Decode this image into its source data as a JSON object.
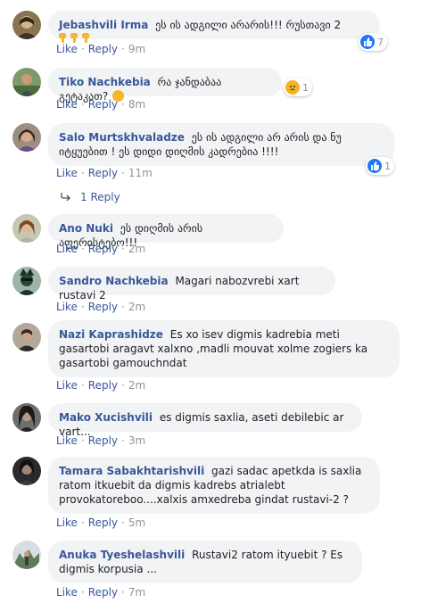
{
  "actions": {
    "like": "Like",
    "reply": "Reply",
    "sep": "·"
  },
  "comments": [
    {
      "author": "Jebashvili Irma",
      "text": "ეს ის ადგილი არარის!!! რუსთავი 2",
      "time": "9m",
      "reaction": {
        "icon": "like-icon",
        "count": "7"
      },
      "emoji": "thumbs-down-icon x3"
    },
    {
      "author": "Tiko Nachkebia",
      "text": "რა ჯანდაბაა გეტაკათ?",
      "time": "8m",
      "reaction": {
        "icon": "sad-icon",
        "count": "1"
      },
      "emoji": "sad-face-icon"
    },
    {
      "author": "Salo Murtskhvaladze",
      "text": "ეს ის ადგილი არ არის და ნუ იტყუებით ! ეს დიდი დიღმის კადრებია !!!!",
      "time": "11m",
      "reaction": {
        "icon": "like-icon",
        "count": "1"
      }
    },
    {
      "author": "Ano Nuki",
      "text": "ეს დიღმის არის აფერისტებო!!!",
      "time": "2m"
    },
    {
      "author": "Sandro Nachkebia",
      "text": "Magari nabozvrebi xart rustavi 2",
      "time": "2m"
    },
    {
      "author": "Nazi Kaprashidze",
      "text": "Es xo isev digmis kadrebia meti gasartobi aragavt xalxno ,madli mouvat xolme zogiers ka gasartobi gamouchndat",
      "time": "2m"
    },
    {
      "author": "Mako Xucishvili",
      "text": "es digmis saxlia, aseti debilebic ar vart...",
      "time": "3m"
    },
    {
      "author": "Tamara Sabakhtarishvili",
      "text": "gazi sadac apetkda is saxlia ratom itkuebit da digmis kadrebs atrialebt provokatoreboo....xalxis amxedreba gindat rustavi-2 ?",
      "time": "5m"
    },
    {
      "author": "Anuka Tyeshelashvili",
      "text": "Rustavi2 ratom ityuebit ? Es digmis korpusia ...",
      "time": "7m"
    }
  ],
  "replies_link": "1 Reply",
  "colors": {
    "link": "#385898",
    "bubble": "#f2f3f5",
    "meta": "#90949c",
    "like_blue": "#2078f4",
    "emoji_yellow": "#f7b125"
  }
}
